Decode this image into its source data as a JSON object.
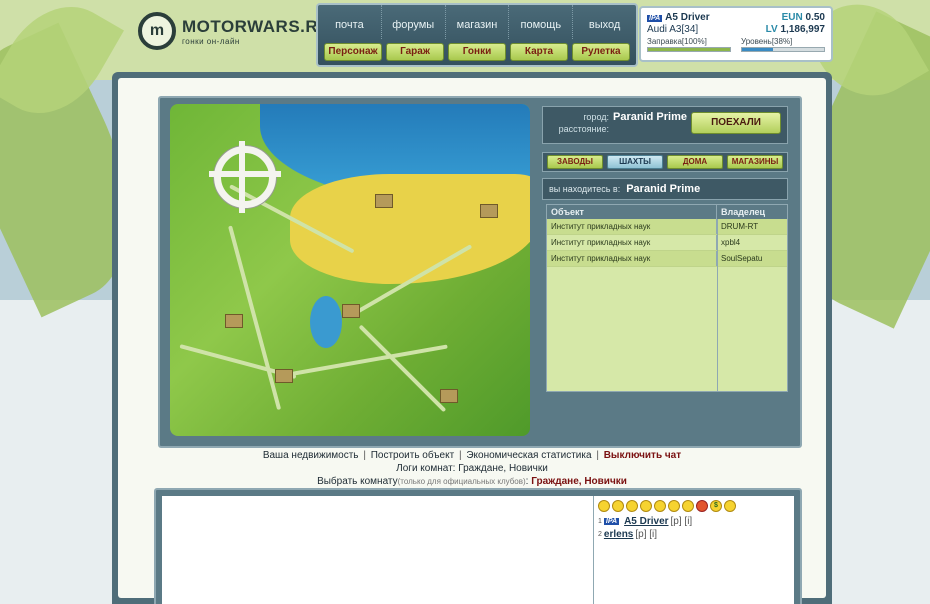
{
  "header": {
    "logo_mark": "m",
    "logo_title": "MOTORWARS.RU",
    "logo_subtitle": "гонки он-лайн",
    "nav_top": [
      "почта",
      "форумы",
      "магазин",
      "помощь",
      "выход"
    ],
    "nav_bottom": [
      "Персонаж",
      "Гараж",
      "Гонки",
      "Карта",
      "Рулетка"
    ]
  },
  "player": {
    "badge": "IPA",
    "name": "A5 Driver",
    "currency_eun_label": "EUN",
    "currency_eun": "0.50",
    "car": "Audi A3[34]",
    "currency_lv_label": "LV",
    "currency_lv": "1,186,997",
    "fuel_label": "Заправка[100%]",
    "fuel_pct": 100,
    "level_label": "Уровень[38%]",
    "level_pct": 38
  },
  "travel": {
    "city_label": "город:",
    "city": "Paranid Prime",
    "distance_label": "расстояние:",
    "go_button": "ПОЕХАЛИ"
  },
  "categories": [
    {
      "label": "ЗАВОДЫ",
      "style": "green"
    },
    {
      "label": "ШАХТЫ",
      "style": "blue"
    },
    {
      "label": "ДОМА",
      "style": "green"
    },
    {
      "label": "МАГАЗИНЫ",
      "style": "green"
    }
  ],
  "location": {
    "label": "вы находитесь в:",
    "city": "Paranid Prime"
  },
  "objects_table": {
    "headers": [
      "Объект",
      "Владелец"
    ],
    "rows": [
      [
        "Институт прикладных наук",
        "DRUM-RT"
      ],
      [
        "Институт прикладных наук",
        "xpbl4"
      ],
      [
        "Институт прикладных наук",
        "SoulSepatu"
      ]
    ]
  },
  "links": {
    "items": [
      "Ваша недвижимость",
      "Построить объект",
      "Экономическая статистика"
    ],
    "strong": "Выключить чат",
    "separator": "|"
  },
  "logs": {
    "label": "Логи комнат:",
    "rooms": "Граждане, Новички"
  },
  "room_select": {
    "label": "Выбрать комнату",
    "note": "(только для официальных клубов)",
    "colon": ":",
    "rooms": "Граждане, Новички"
  },
  "chat_users": [
    {
      "idx": "1",
      "badge": "IPA",
      "name": "A5 Driver",
      "tags": "[p] [i]"
    },
    {
      "idx": "2",
      "badge": "",
      "name": "erlens",
      "tags": "[p] [i]"
    }
  ],
  "smileys": [
    "smile",
    "smile",
    "smile",
    "cool",
    "smile",
    "smile",
    "laugh",
    "angry",
    "cash",
    "smile"
  ]
}
